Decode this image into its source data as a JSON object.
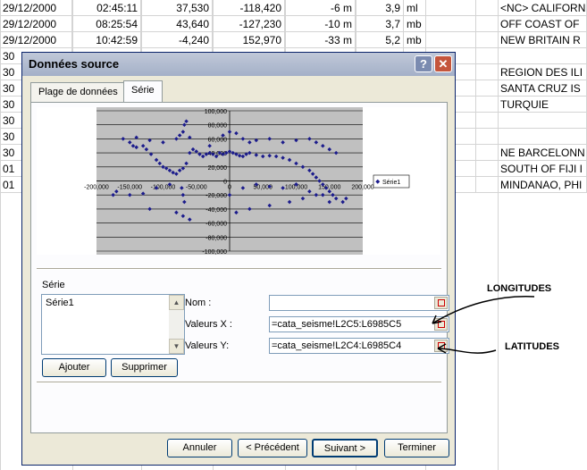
{
  "sheet": {
    "rows": [
      [
        "29/12/2000",
        "02:45:11",
        "37,530",
        "-118,420",
        "-6 m",
        "3,9",
        "ml",
        "<NC> CALIFORNIA"
      ],
      [
        "29/12/2000",
        "08:25:54",
        "43,640",
        "-127,230",
        "-10 m",
        "3,7",
        "mb",
        "OFF COAST OF"
      ],
      [
        "29/12/2000",
        "10:42:59",
        "-4,240",
        "152,970",
        "-33 m",
        "5,2",
        "mb",
        "NEW BRITAIN R"
      ],
      [
        "30",
        "",
        "",
        "",
        "",
        "",
        "",
        ""
      ],
      [
        "30",
        "",
        "",
        "",
        "",
        "",
        "",
        "REGION DES ILI"
      ],
      [
        "30",
        "",
        "",
        "",
        "",
        "",
        "",
        "SANTA CRUZ IS"
      ],
      [
        "30",
        "",
        "",
        "",
        "",
        "",
        "",
        "TURQUIE"
      ],
      [
        "30",
        "",
        "",
        "",
        "",
        "",
        "",
        ""
      ],
      [
        "30",
        "",
        "",
        "",
        "",
        "",
        "",
        ""
      ],
      [
        "30",
        "",
        "",
        "",
        "",
        "",
        "",
        "NE BARCELONN"
      ],
      [
        "01",
        "",
        "",
        "",
        "",
        "",
        "",
        "SOUTH OF FIJI I"
      ],
      [
        "01",
        "",
        "",
        "",
        "",
        "",
        "",
        "MINDANAO, PHI"
      ]
    ]
  },
  "dialog": {
    "title": "Données source",
    "help_glyph": "?",
    "close_glyph": "✕",
    "tabs": [
      "Plage de données",
      "Série"
    ]
  },
  "chart_data": {
    "type": "scatter",
    "title": "",
    "xlabel": "",
    "ylabel": "",
    "xlim": [
      -200000,
      200000
    ],
    "ylim": [
      -100000,
      100000
    ],
    "x_ticks": [
      "-200,000",
      "-150,000",
      "-100,000",
      "-50,000",
      "0",
      "50,000",
      "100,000",
      "150,000",
      "200,000"
    ],
    "y_ticks": [
      "100,000",
      "80,000",
      "60,000",
      "40,000",
      "20,000",
      "0",
      "-20,000",
      "-40,000",
      "-60,000",
      "-80,000",
      "-100,000"
    ],
    "legend": "right",
    "series": [
      {
        "name": "Série1",
        "color": "#1c1c8c",
        "x": [
          -150000,
          -145000,
          -140000,
          -130000,
          -125000,
          -118000,
          -110000,
          -105000,
          -100000,
          -95000,
          -90000,
          -85000,
          -80000,
          -75000,
          -70000,
          -65000,
          -60000,
          -55000,
          -50000,
          -45000,
          -40000,
          -35000,
          -30000,
          -25000,
          -20000,
          -15000,
          -10000,
          -5000,
          0,
          5000,
          10000,
          15000,
          20000,
          25000,
          30000,
          40000,
          50000,
          60000,
          70000,
          80000,
          90000,
          100000,
          110000,
          120000,
          125000,
          130000,
          135000,
          140000,
          145000,
          150000,
          155000,
          -160000,
          -140000,
          -120000,
          -100000,
          -80000,
          -75000,
          -70000,
          -68000,
          -65000,
          -60000,
          -10000,
          0,
          10000,
          20000,
          30000,
          40000,
          60000,
          80000,
          100000,
          120000,
          130000,
          140000,
          150000,
          160000,
          -170000,
          -150000,
          -130000,
          -110000,
          -90000,
          -72000,
          -70000,
          -68000,
          0,
          20000,
          40000,
          60000,
          80000,
          100000,
          120000,
          140000,
          160000,
          170000,
          -120000,
          -80000,
          -70000,
          -60000,
          30000,
          60000,
          90000,
          110000,
          130000,
          150000,
          -175000,
          175000,
          -30000,
          10000,
          100000
        ],
        "y": [
          55000,
          50000,
          48000,
          50000,
          45000,
          38000,
          30000,
          25000,
          20000,
          18000,
          15000,
          12000,
          10000,
          15000,
          18000,
          25000,
          40000,
          45000,
          42000,
          38000,
          35000,
          38000,
          40000,
          38000,
          35000,
          40000,
          38000,
          40000,
          42000,
          40000,
          38000,
          36000,
          35000,
          38000,
          40000,
          37000,
          35000,
          36000,
          35000,
          33000,
          30000,
          25000,
          20000,
          15000,
          10000,
          5000,
          0,
          -5000,
          -10000,
          -15000,
          -20000,
          60000,
          62000,
          58000,
          55000,
          60000,
          65000,
          70000,
          80000,
          85000,
          62000,
          65000,
          70000,
          68000,
          60000,
          55000,
          58000,
          60000,
          55000,
          58000,
          60000,
          55000,
          50000,
          45000,
          40000,
          -15000,
          -20000,
          -18000,
          -10000,
          -5000,
          -10000,
          -20000,
          -30000,
          -20000,
          -10000,
          -5000,
          -8000,
          -10000,
          -5000,
          -15000,
          -20000,
          -25000,
          -30000,
          -40000,
          -45000,
          -50000,
          -55000,
          -40000,
          -35000,
          -30000,
          -25000,
          -20000,
          -30000,
          -20000,
          -25000,
          50000,
          -45000,
          -5000
        ]
      }
    ]
  },
  "serie_section": {
    "label": "Série",
    "items": [
      "Série1"
    ],
    "add_button": "Ajouter",
    "remove_button": "Supprimer",
    "name_label": "Nom :",
    "name_value": "",
    "x_label": "Valeurs X :",
    "x_value": "=cata_seisme!L2C5:L6985C5",
    "y_label": "Valeurs Y:",
    "y_value": "=cata_seisme!L2C4:L6985C4"
  },
  "footer": {
    "cancel": "Annuler",
    "prev": "< Précédent",
    "next": "Suivant >",
    "finish": "Terminer"
  },
  "annotations": {
    "longitudes": "LONGITUDES",
    "latitudes": "LATITUDES"
  }
}
